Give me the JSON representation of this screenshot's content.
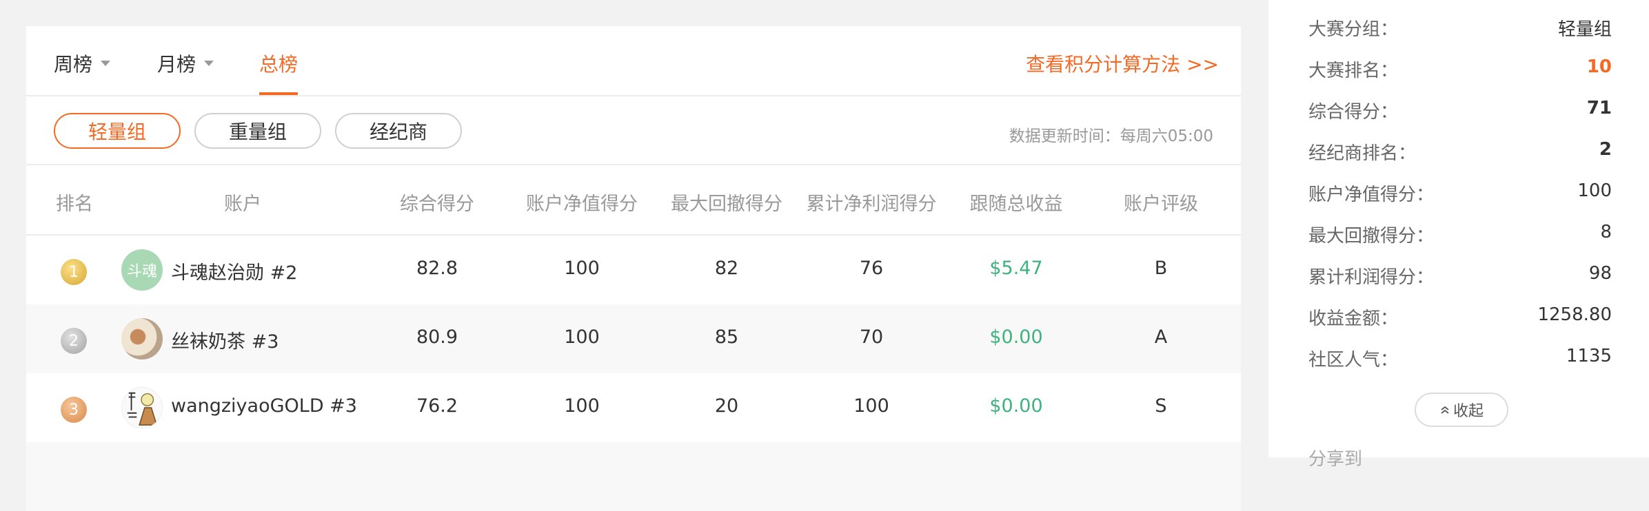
{
  "tabs": {
    "weekly": "周榜",
    "monthly": "月榜",
    "total": "总榜",
    "calc_link": "查看积分计算方法 >>"
  },
  "groups": {
    "light": "轻量组",
    "heavy": "重量组",
    "broker": "经纪商",
    "update_time": "数据更新时间：每周六05:00"
  },
  "table": {
    "headers": {
      "rank": "排名",
      "account": "账户",
      "score": "综合得分",
      "equity": "账户净值得分",
      "drawdown": "最大回撤得分",
      "profit": "累计净利润得分",
      "follow": "跟随总收益",
      "rating": "账户评级"
    },
    "rows": [
      {
        "rank": "1",
        "avatar": "斗魂",
        "name": "斗魂赵治勋 #2",
        "score": "82.8",
        "equity": "100",
        "drawdown": "82",
        "profit": "76",
        "follow": "$5.47",
        "rating": "B"
      },
      {
        "rank": "2",
        "avatar": "",
        "name": "丝袜奶茶 #3",
        "score": "80.9",
        "equity": "100",
        "drawdown": "85",
        "profit": "70",
        "follow": "$0.00",
        "rating": "A"
      },
      {
        "rank": "3",
        "avatar": "",
        "name": "wangziyaoGOLD #3",
        "score": "76.2",
        "equity": "100",
        "drawdown": "20",
        "profit": "100",
        "follow": "$0.00",
        "rating": "S"
      }
    ]
  },
  "sidebar": {
    "items": [
      {
        "label": "大赛分组：",
        "value": "轻量组"
      },
      {
        "label": "大赛排名：",
        "value": "10"
      },
      {
        "label": "综合得分：",
        "value": "71"
      },
      {
        "label": "经纪商排名：",
        "value": "2"
      },
      {
        "label": "账户净值得分：",
        "value": "100"
      },
      {
        "label": "最大回撤得分：",
        "value": "8"
      },
      {
        "label": "累计利润得分：",
        "value": "98"
      },
      {
        "label": "收益金额：",
        "value": "1258.80"
      },
      {
        "label": "社区人气：",
        "value": "1135"
      }
    ],
    "collapse": "收起",
    "share": "分享到"
  },
  "colors": {
    "accent": "#f46a25",
    "positive": "#3fb27f"
  }
}
